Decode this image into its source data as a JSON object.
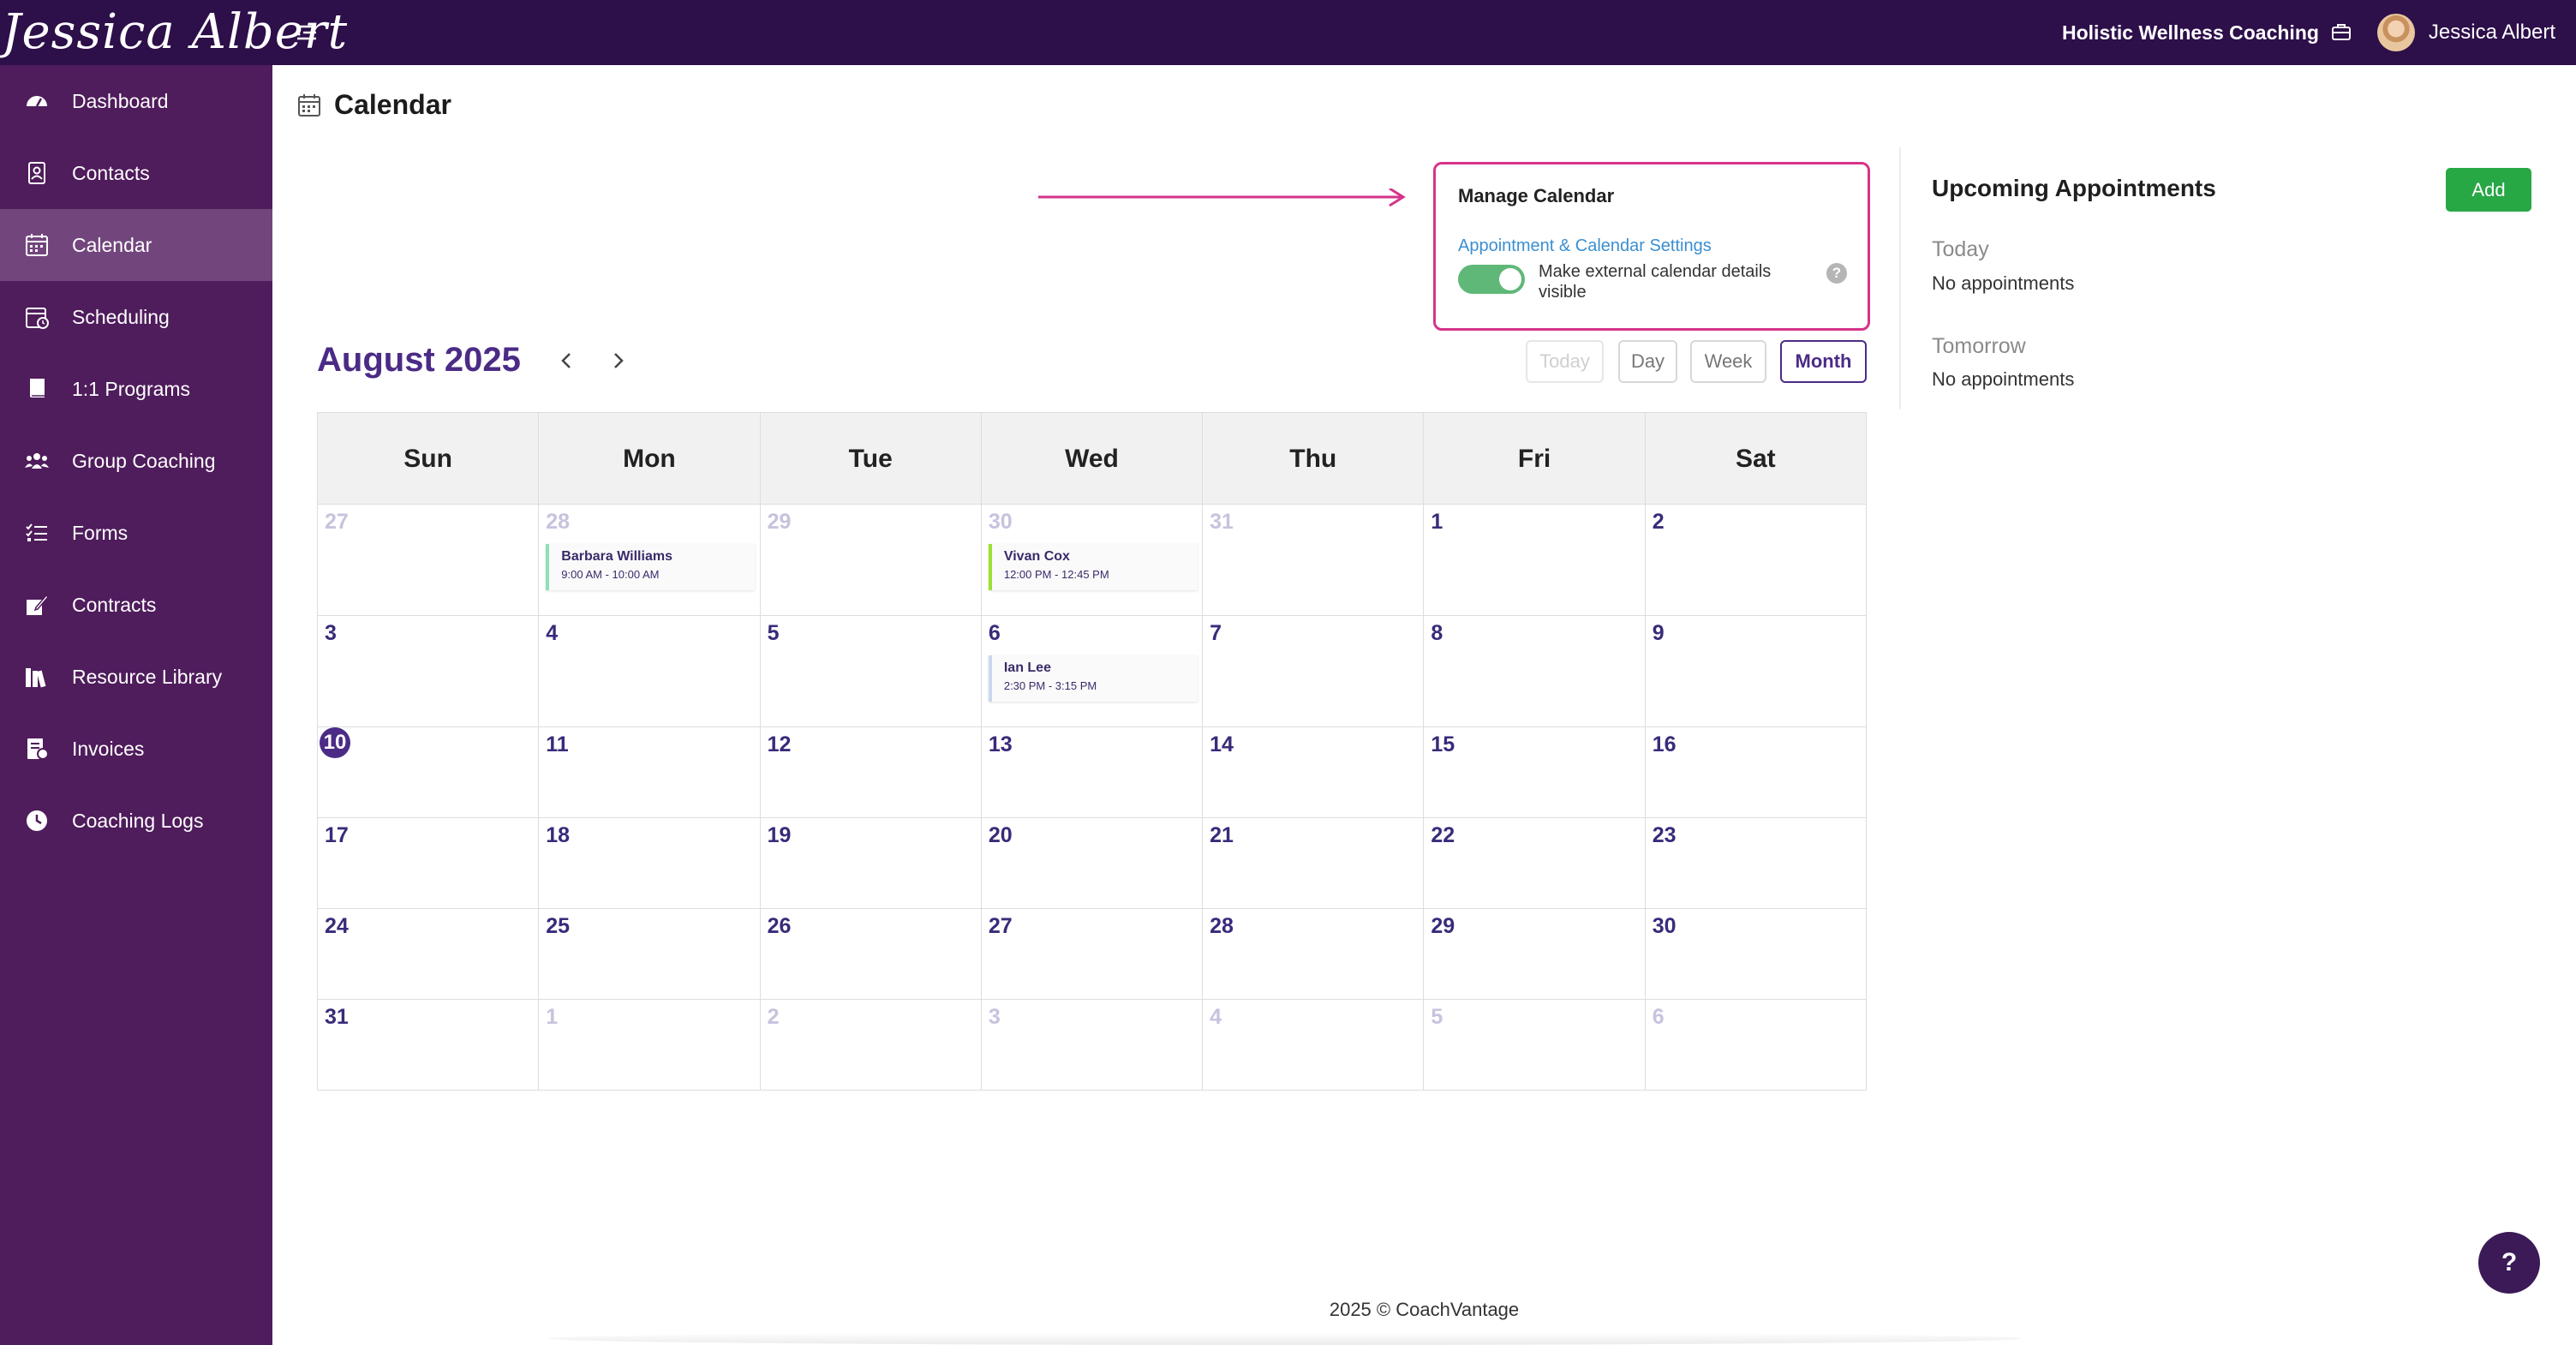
{
  "brand": {
    "logo_text": "Jessica Albert"
  },
  "header": {
    "business_name": "Holistic Wellness Coaching",
    "user_name": "Jessica Albert"
  },
  "sidebar": {
    "items": [
      {
        "label": "Dashboard",
        "icon": "dashboard-icon"
      },
      {
        "label": "Contacts",
        "icon": "contacts-icon"
      },
      {
        "label": "Calendar",
        "icon": "calendar-icon",
        "active": true
      },
      {
        "label": "Scheduling",
        "icon": "scheduling-icon"
      },
      {
        "label": "1:1 Programs",
        "icon": "book-icon"
      },
      {
        "label": "Group Coaching",
        "icon": "group-icon"
      },
      {
        "label": "Forms",
        "icon": "forms-icon"
      },
      {
        "label": "Contracts",
        "icon": "contract-icon"
      },
      {
        "label": "Resource Library",
        "icon": "library-icon"
      },
      {
        "label": "Invoices",
        "icon": "invoice-icon"
      },
      {
        "label": "Coaching Logs",
        "icon": "clock-icon"
      }
    ]
  },
  "page": {
    "title": "Calendar"
  },
  "manage": {
    "title": "Manage Calendar",
    "link": "Appointment & Calendar Settings",
    "toggle_label": "Make external calendar details visible",
    "toggle_on": true,
    "help": "?"
  },
  "calendar": {
    "month_title": "August 2025",
    "views": {
      "today": "Today",
      "day": "Day",
      "week": "Week",
      "month": "Month"
    },
    "active_view": "Month",
    "weekdays": [
      "Sun",
      "Mon",
      "Tue",
      "Wed",
      "Thu",
      "Fri",
      "Sat"
    ],
    "weeks": [
      [
        {
          "d": "27",
          "muted": true
        },
        {
          "d": "28",
          "muted": true
        },
        {
          "d": "29",
          "muted": true
        },
        {
          "d": "30",
          "muted": true
        },
        {
          "d": "31",
          "muted": true
        },
        {
          "d": "1"
        },
        {
          "d": "2"
        }
      ],
      [
        {
          "d": "3"
        },
        {
          "d": "4"
        },
        {
          "d": "5"
        },
        {
          "d": "6"
        },
        {
          "d": "7"
        },
        {
          "d": "8"
        },
        {
          "d": "9"
        }
      ],
      [
        {
          "d": "10",
          "today": true
        },
        {
          "d": "11"
        },
        {
          "d": "12"
        },
        {
          "d": "13"
        },
        {
          "d": "14"
        },
        {
          "d": "15"
        },
        {
          "d": "16"
        }
      ],
      [
        {
          "d": "17"
        },
        {
          "d": "18"
        },
        {
          "d": "19"
        },
        {
          "d": "20"
        },
        {
          "d": "21"
        },
        {
          "d": "22"
        },
        {
          "d": "23"
        }
      ],
      [
        {
          "d": "24"
        },
        {
          "d": "25"
        },
        {
          "d": "26"
        },
        {
          "d": "27"
        },
        {
          "d": "28"
        },
        {
          "d": "29"
        },
        {
          "d": "30"
        }
      ],
      [
        {
          "d": "31"
        },
        {
          "d": "1",
          "muted": true
        },
        {
          "d": "2",
          "muted": true
        },
        {
          "d": "3",
          "muted": true
        },
        {
          "d": "4",
          "muted": true
        },
        {
          "d": "5",
          "muted": true
        },
        {
          "d": "6",
          "muted": true
        }
      ]
    ],
    "events": [
      {
        "week": 0,
        "day": 1,
        "name": "Barbara Williams",
        "time": "9:00 AM - 10:00 AM",
        "color": "#8fe0b5"
      },
      {
        "week": 0,
        "day": 3,
        "name": "Vivan Cox",
        "time": "12:00 PM - 12:45 PM",
        "color": "#9ee02f"
      },
      {
        "week": 1,
        "day": 3,
        "name": "Ian Lee",
        "time": "2:30 PM - 3:15 PM",
        "color": "#c8d8ee"
      }
    ]
  },
  "upcoming": {
    "title": "Upcoming Appointments",
    "add_label": "Add",
    "today_label": "Today",
    "today_text": "No appointments",
    "tomorrow_label": "Tomorrow",
    "tomorrow_text": "No appointments"
  },
  "footer": {
    "text": "2025 © CoachVantage"
  },
  "help_button": "?",
  "colors": {
    "topbar": "#2d0f4a",
    "sidebar": "#4f1c5c",
    "accent": "#4b2b86",
    "highlight": "#d6338a",
    "add": "#28a745"
  }
}
